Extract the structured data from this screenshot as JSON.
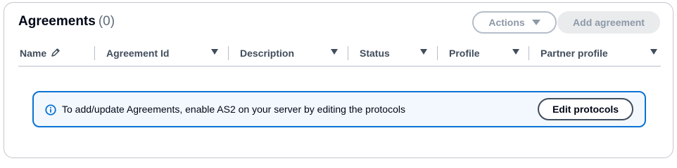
{
  "header": {
    "title": "Agreements",
    "count": "(0)",
    "actions_label": "Actions",
    "add_label": "Add agreement"
  },
  "table": {
    "columns": [
      {
        "label": "Name",
        "icon": "pencil-icon"
      },
      {
        "label": "Agreement Id"
      },
      {
        "label": "Description"
      },
      {
        "label": "Status"
      },
      {
        "label": "Profile"
      },
      {
        "label": "Partner profile"
      }
    ]
  },
  "alert": {
    "icon": "info-icon",
    "message": "To add/update Agreements, enable AS2 on your server by editing the protocols",
    "button_label": "Edit protocols"
  },
  "colors": {
    "accent": "#0972d3",
    "alert_bg": "#f2f8fd",
    "disabled_text": "#8d99a8"
  }
}
